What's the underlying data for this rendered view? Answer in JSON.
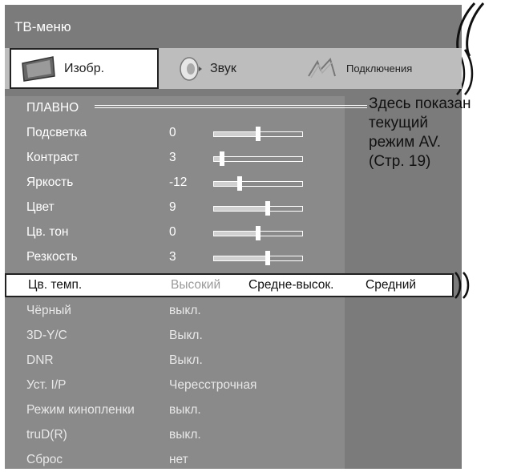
{
  "window": {
    "title": "ТВ-меню"
  },
  "tabs": [
    {
      "label": "Изобр.",
      "icon": "tv-screen-icon",
      "active": true
    },
    {
      "label": "Звук",
      "icon": "speaker-icon",
      "active": false
    },
    {
      "label": "Подключения",
      "icon": "connection-icon",
      "active": false
    }
  ],
  "mode": {
    "label": "ПЛАВНО"
  },
  "callout": {
    "line1": "Здесь показан",
    "line2": "текущий",
    "line3": "режим AV.",
    "line4": "(Стр. 19)"
  },
  "sliders": [
    {
      "label": "Подсветка",
      "value": "0",
      "level": 0.5
    },
    {
      "label": "Контраст",
      "value": "3",
      "level": 0.07
    },
    {
      "label": "Яркость",
      "value": "-12",
      "level": 0.28
    },
    {
      "label": "Цвет",
      "value": "9",
      "level": 0.62
    },
    {
      "label": "Цв. тон",
      "value": "0",
      "level": 0.5
    },
    {
      "label": "Резкость",
      "value": "3",
      "level": 0.62
    }
  ],
  "color_temp": {
    "label": "Цв. темп.",
    "options": [
      "Высокий",
      "Средне-высок.",
      "Средний"
    ]
  },
  "settings": [
    {
      "label": "Чёрный",
      "value": "выкл."
    },
    {
      "label": "3D-Y/C",
      "value": "Выкл."
    },
    {
      "label": "DNR",
      "value": "Выкл."
    },
    {
      "label": "Уст. I/P",
      "value": "Чересстрочная"
    },
    {
      "label": "Режим кинопленки",
      "value": "выкл."
    },
    {
      "label": "truD(R)",
      "value": "выкл."
    },
    {
      "label": "Сброс",
      "value": "нет"
    }
  ]
}
